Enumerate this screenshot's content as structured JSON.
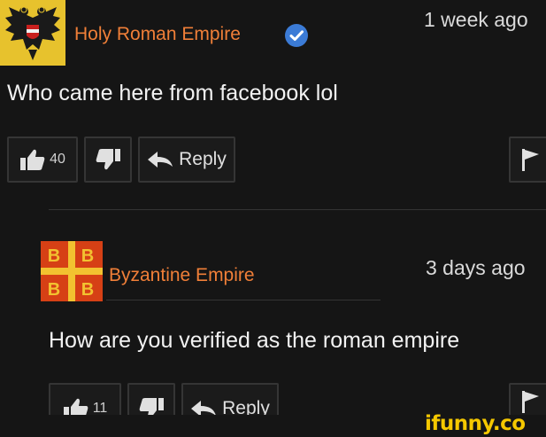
{
  "comment_1": {
    "username": "Holy Roman Empire",
    "verified": true,
    "timestamp": "1 week ago",
    "text": "Who came here from facebook lol",
    "likes": "40",
    "reply_label": "Reply"
  },
  "comment_2": {
    "username": "Byzantine Empire",
    "timestamp": "3 days ago",
    "text": "How are you verified as the roman empire",
    "likes": "11",
    "reply_label": "Reply"
  },
  "watermark": "ifunny.co",
  "colors": {
    "background": "#151515",
    "username": "#f07f38",
    "verified_badge": "#3b7bd6",
    "hre_avatar_bg": "#e7c22d",
    "byz_avatar_bg": "#d64015",
    "watermark": "#f5c800"
  }
}
